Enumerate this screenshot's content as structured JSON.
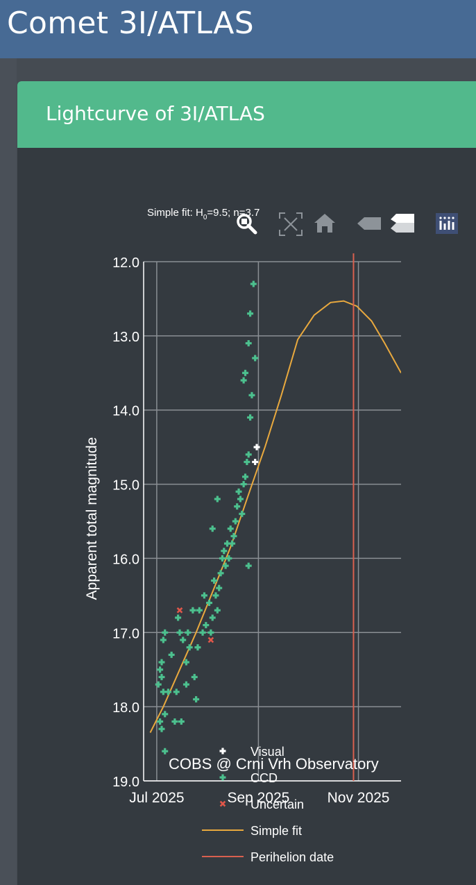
{
  "page": {
    "title": "Comet 3I/ATLAS",
    "card_title": "Lightcurve of 3I/ATLAS"
  },
  "colors": {
    "topbar": "#476a94",
    "card_header": "#52b98c",
    "plot_bg": "#343a40",
    "ccd": "#4cc08e",
    "visual": "#ffffff",
    "uncertain": "#e0574a",
    "fit": "#e9a93e",
    "perihelion": "#d9604f"
  },
  "modebar": {
    "icons": [
      "zoom-icon",
      "autoscale-icon",
      "reset-axes-home-icon",
      "hover-closest-icon",
      "hover-compare-icon",
      "plotly-logo-icon"
    ]
  },
  "chart_data": {
    "type": "scatter",
    "subtitle": "Simple fit: H₀=9.5; n=3.7",
    "subtitle_prefix": "Simple fit: H",
    "subtitle_sub": "0",
    "subtitle_suffix": "=9.5; n=3.7",
    "ylabel": "Apparent total magnitude",
    "xlabel": "",
    "ylim": [
      19.0,
      12.0
    ],
    "y_reversed": true,
    "xlim": [
      "2025-06-23",
      "2025-11-27"
    ],
    "x_ticks": [
      {
        "date": "2025-07-01",
        "label": "Jul 2025"
      },
      {
        "date": "2025-09-01",
        "label": "Sep 2025"
      },
      {
        "date": "2025-11-01",
        "label": "Nov 2025"
      }
    ],
    "y_ticks": [
      "12.0",
      "13.0",
      "14.0",
      "15.0",
      "16.0",
      "17.0",
      "18.0",
      "19.0"
    ],
    "grid": true,
    "annotation": "COBS @ Crni Vrh Observatory",
    "legend_position": "bottom",
    "series": [
      {
        "name": "Visual",
        "marker": "cross",
        "points": [
          [
            "2025-08-31",
            14.5
          ],
          [
            "2025-08-30",
            14.7
          ]
        ]
      },
      {
        "name": "CCD",
        "marker": "cross",
        "points": [
          [
            "2025-07-02",
            17.7
          ],
          [
            "2025-07-03",
            17.5
          ],
          [
            "2025-07-04",
            17.6
          ],
          [
            "2025-07-05",
            17.8
          ],
          [
            "2025-07-06",
            18.1
          ],
          [
            "2025-07-04",
            18.3
          ],
          [
            "2025-07-03",
            18.2
          ],
          [
            "2025-07-05",
            17.1
          ],
          [
            "2025-07-06",
            17.0
          ],
          [
            "2025-07-04",
            17.4
          ],
          [
            "2025-07-06",
            18.6
          ],
          [
            "2025-07-08",
            17.8
          ],
          [
            "2025-07-10",
            17.3
          ],
          [
            "2025-07-12",
            18.2
          ],
          [
            "2025-07-13",
            17.8
          ],
          [
            "2025-07-14",
            16.8
          ],
          [
            "2025-07-15",
            17.0
          ],
          [
            "2025-07-17",
            17.1
          ],
          [
            "2025-07-19",
            17.4
          ],
          [
            "2025-07-20",
            17.0
          ],
          [
            "2025-07-21",
            17.2
          ],
          [
            "2025-07-23",
            16.7
          ],
          [
            "2025-07-24",
            17.6
          ],
          [
            "2025-07-25",
            17.9
          ],
          [
            "2025-07-26",
            17.2
          ],
          [
            "2025-07-27",
            16.7
          ],
          [
            "2025-07-29",
            17.0
          ],
          [
            "2025-07-30",
            16.5
          ],
          [
            "2025-07-31",
            16.9
          ],
          [
            "2025-08-02",
            16.6
          ],
          [
            "2025-08-03",
            17.0
          ],
          [
            "2025-08-04",
            16.8
          ],
          [
            "2025-08-05",
            16.3
          ],
          [
            "2025-08-06",
            16.5
          ],
          [
            "2025-08-07",
            16.7
          ],
          [
            "2025-08-08",
            16.4
          ],
          [
            "2025-08-09",
            16.2
          ],
          [
            "2025-08-10",
            16.0
          ],
          [
            "2025-08-11",
            15.9
          ],
          [
            "2025-08-12",
            16.1
          ],
          [
            "2025-08-13",
            15.8
          ],
          [
            "2025-08-14",
            16.0
          ],
          [
            "2025-08-15",
            15.6
          ],
          [
            "2025-08-16",
            15.8
          ],
          [
            "2025-08-17",
            15.7
          ],
          [
            "2025-08-18",
            15.5
          ],
          [
            "2025-08-19",
            15.3
          ],
          [
            "2025-08-20",
            15.1
          ],
          [
            "2025-08-21",
            15.2
          ],
          [
            "2025-08-22",
            15.4
          ],
          [
            "2025-08-23",
            15.0
          ],
          [
            "2025-08-24",
            14.9
          ],
          [
            "2025-08-25",
            14.7
          ],
          [
            "2025-08-26",
            14.6
          ],
          [
            "2025-08-27",
            14.1
          ],
          [
            "2025-08-28",
            13.8
          ],
          [
            "2025-08-23",
            13.6
          ],
          [
            "2025-08-24",
            13.5
          ],
          [
            "2025-08-26",
            13.1
          ],
          [
            "2025-08-27",
            12.7
          ],
          [
            "2025-08-29",
            12.3
          ],
          [
            "2025-08-30",
            13.3
          ],
          [
            "2025-08-26",
            16.1
          ],
          [
            "2025-08-07",
            15.2
          ],
          [
            "2025-08-04",
            15.6
          ],
          [
            "2025-07-19",
            17.7
          ],
          [
            "2025-07-16",
            18.2
          ]
        ]
      },
      {
        "name": "Uncertain",
        "marker": "x",
        "points": [
          [
            "2025-07-15",
            16.7
          ],
          [
            "2025-08-03",
            17.1
          ]
        ]
      }
    ],
    "fit": {
      "name": "Simple fit",
      "points": [
        [
          "2025-06-27",
          18.35
        ],
        [
          "2025-07-05",
          18.0
        ],
        [
          "2025-07-15",
          17.5
        ],
        [
          "2025-07-25",
          17.0
        ],
        [
          "2025-08-05",
          16.4
        ],
        [
          "2025-08-15",
          15.85
        ],
        [
          "2025-08-25",
          15.2
        ],
        [
          "2025-09-05",
          14.5
        ],
        [
          "2025-09-15",
          13.8
        ],
        [
          "2025-09-25",
          13.05
        ],
        [
          "2025-10-05",
          12.72
        ],
        [
          "2025-10-15",
          12.55
        ],
        [
          "2025-10-23",
          12.53
        ],
        [
          "2025-10-31",
          12.6
        ],
        [
          "2025-11-09",
          12.8
        ],
        [
          "2025-11-17",
          13.1
        ],
        [
          "2025-11-27",
          13.5
        ]
      ]
    },
    "perihelion": {
      "name": "Perihelion date",
      "date": "2025-10-29"
    }
  }
}
